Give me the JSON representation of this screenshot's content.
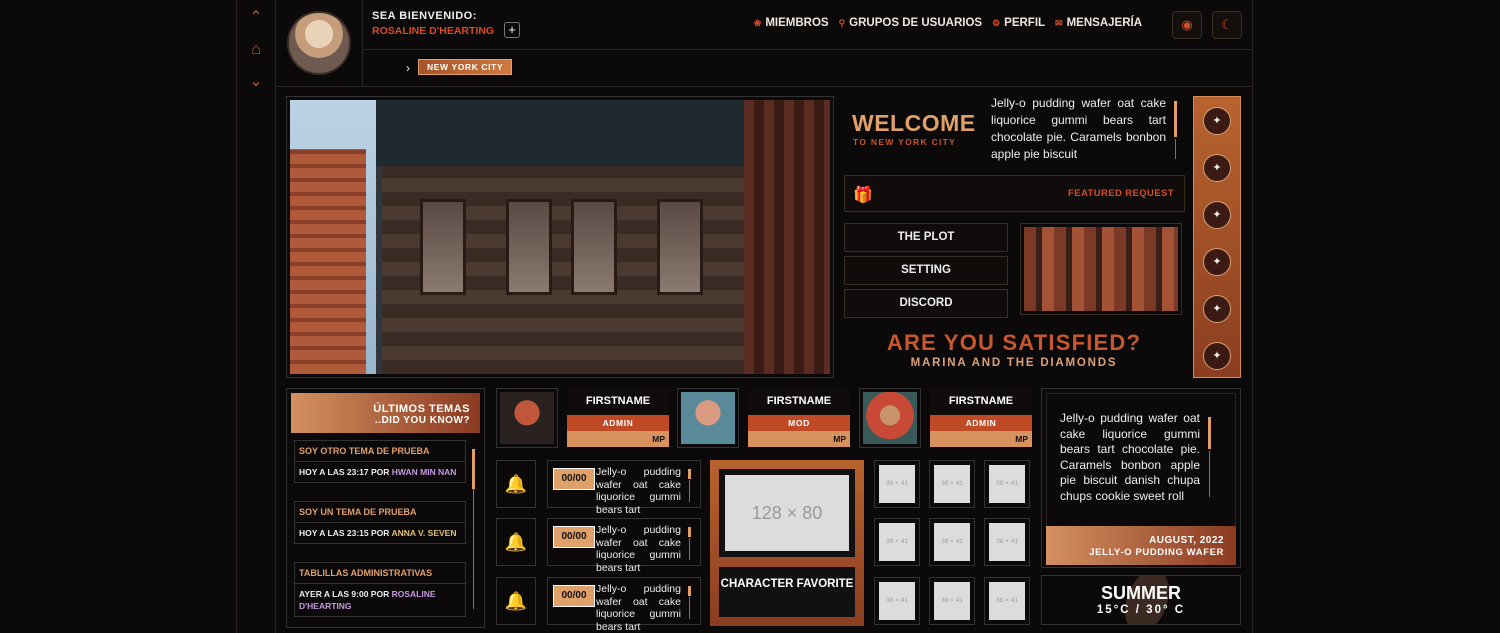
{
  "rail": {
    "up_icon": "chevron-up-icon",
    "home_icon": "home-icon",
    "down_icon": "chevron-down-icon"
  },
  "user": {
    "greeting": "SEA BIENVENIDO:",
    "name": "ROSALINE D'HEARTING",
    "plus": "+"
  },
  "nav": [
    {
      "icon": "paw-icon",
      "label": "MIEMBROS"
    },
    {
      "icon": "pin-icon",
      "label": "GRUPOS DE USUARIOS"
    },
    {
      "icon": "gear-icon",
      "label": "PERFIL"
    },
    {
      "icon": "envelope-icon",
      "label": "MENSAJERÍA"
    }
  ],
  "breadcrumb": {
    "current": "NEW YORK CITY"
  },
  "welcome": {
    "title": "WELCOME",
    "subtitle": "TO NEW YORK CITY",
    "text": "Jelly-o pudding wafer oat cake liquorice gummi bears tart chocolate pie. Caramels bonbon apple pie biscuit"
  },
  "featured": {
    "label": "FEATURED REQUEST"
  },
  "menu": [
    "THE PLOT",
    "SETTING",
    "DISCORD"
  ],
  "song": {
    "title": "ARE YOU SATISFIED?",
    "artist": "MARINA AND THE DIAMONDS"
  },
  "topics": {
    "title": "ÚLTIMOS TEMAS",
    "subtitle": "..DID YOU KNOW?",
    "items": [
      {
        "title": "SOY OTRO TEMA DE PRUEBA",
        "meta": "HOY A LAS 23:17 POR ",
        "author": "HWAN MIN NAN"
      },
      {
        "title": "SOY UN TEMA DE PRUEBA",
        "meta": "HOY A LAS 23:15 POR ",
        "author": "ANNA V. SEVEN"
      },
      {
        "title": "TABLILLAS ADMINISTRATIVAS",
        "meta": "AYER A LAS 9:00 POR ",
        "author": "ROSALINE D'HEARTING"
      }
    ]
  },
  "staff": [
    {
      "name": "FIRSTNAME",
      "rank": "ADMIN",
      "mp": "MP"
    },
    {
      "name": "FIRSTNAME",
      "rank": "MOD",
      "mp": "MP"
    },
    {
      "name": "FIRSTNAME",
      "rank": "ADMIN",
      "mp": "MP"
    }
  ],
  "notifications": [
    {
      "count": "00/00",
      "text": "Jelly-o pudding wafer oat cake liquorice gummi bears tart"
    },
    {
      "count": "00/00",
      "text": "Jelly-o pudding wafer oat cake liquorice gummi bears tart"
    },
    {
      "count": "00/00",
      "text": "Jelly-o pudding wafer oat cake liquorice gummi bears tart"
    }
  ],
  "character": {
    "placeholder": "128 × 80",
    "label": "CHARACTER FAVORITE"
  },
  "grid_placeholder": "38 × 41",
  "info": {
    "text": "Jelly-o pudding wafer oat cake liquorice gummi bears tart chocolate pie. Caramels bonbon apple pie biscuit danish chupa chups cookie sweet roll",
    "date": "AUGUST, 2022",
    "caption": "JELLY-O PUDDING WAFER"
  },
  "weather": {
    "season": "SUMMER",
    "temps": "15°C / 30° C"
  },
  "colors": {
    "accent": "#c8572e",
    "gold": "#e0a06a",
    "bg": "#0b0909"
  }
}
